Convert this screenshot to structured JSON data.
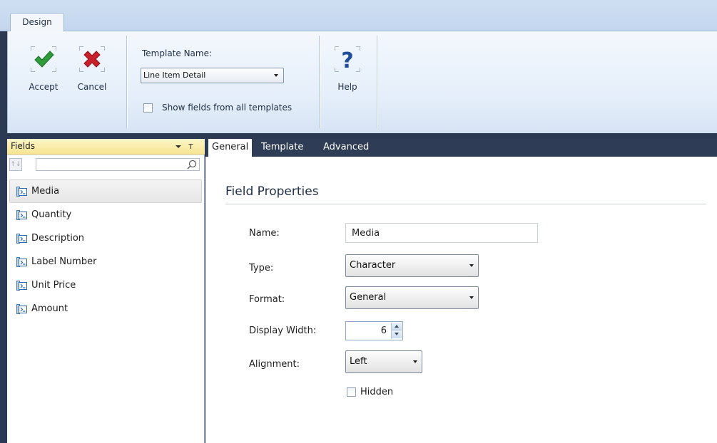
{
  "ribbon": {
    "tab_label": "Design",
    "accept_label": "Accept",
    "cancel_label": "Cancel",
    "help_label": "Help",
    "template_name_label": "Template Name:",
    "template_name_value": "Line Item Detail",
    "show_all_fields_label": "Show fields from all templates",
    "show_all_fields_checked": false
  },
  "fields_panel": {
    "title": "Fields",
    "search_value": "",
    "selected_index": 0,
    "items": [
      {
        "label": "Media"
      },
      {
        "label": "Quantity"
      },
      {
        "label": "Description"
      },
      {
        "label": "Label Number"
      },
      {
        "label": "Unit Price"
      },
      {
        "label": "Amount"
      }
    ]
  },
  "properties": {
    "tabs": [
      {
        "label": "General",
        "active": true
      },
      {
        "label": "Template",
        "active": false
      },
      {
        "label": "Advanced",
        "active": false
      }
    ],
    "section_title": "Field Properties",
    "name_label": "Name:",
    "name_value": "Media",
    "type_label": "Type:",
    "type_value": "Character",
    "format_label": "Format:",
    "format_value": "General",
    "display_width_label": "Display Width:",
    "display_width_value": "6",
    "alignment_label": "Alignment:",
    "alignment_value": "Left",
    "hidden_label": "Hidden",
    "hidden_checked": false
  },
  "colors": {
    "accent_dark": "#2e3d55",
    "accept_icon": "#2f9a3a",
    "cancel_icon": "#c8202a",
    "help_icon": "#1f4f9a",
    "panel_header": "#f7e592"
  }
}
